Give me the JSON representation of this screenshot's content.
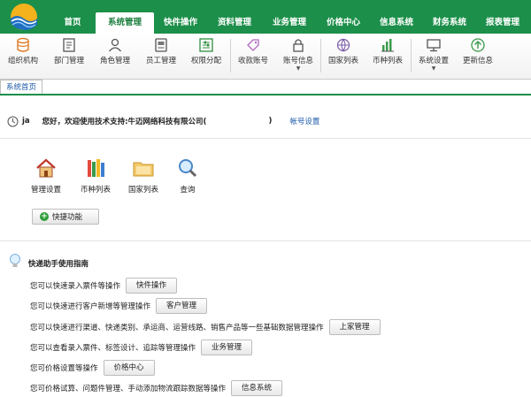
{
  "nav": {
    "items": [
      "首页",
      "系统管理",
      "快件操作",
      "资料管理",
      "业务管理",
      "价格中心",
      "信息系统",
      "财务系统",
      "报表管理"
    ],
    "active": "系统管理"
  },
  "toolbar": {
    "items": [
      {
        "label": "组织机构",
        "icon": "database-icon"
      },
      {
        "label": "部门管理",
        "icon": "document-icon"
      },
      {
        "label": "角色管理",
        "icon": "user-icon"
      },
      {
        "label": "员工管理",
        "icon": "id-card-icon"
      },
      {
        "label": "权限分配",
        "icon": "sliders-icon"
      },
      {
        "label": "收款账号",
        "icon": "tag-icon"
      },
      {
        "label": "账号信息",
        "icon": "lock-icon"
      },
      {
        "label": "国家列表",
        "icon": "globe-icon"
      },
      {
        "label": "币种列表",
        "icon": "bar-chart-icon"
      },
      {
        "label": "系统设置",
        "icon": "monitor-icon"
      },
      {
        "label": "更新信息",
        "icon": "up-arrow-icon"
      }
    ]
  },
  "tabs": {
    "home": "系统首页"
  },
  "welcome": {
    "user": "ja",
    "text": "您好，欢迎使用技术支持:牛迈网络科技有限公司(",
    "close": ")",
    "account_link": "帐号设置"
  },
  "shortcuts": {
    "items": [
      {
        "label": "管理设置",
        "icon": "house-icon"
      },
      {
        "label": "币种列表",
        "icon": "books-icon"
      },
      {
        "label": "国家列表",
        "icon": "folder-icon"
      },
      {
        "label": "查询",
        "icon": "magnifier-icon"
      }
    ],
    "quick_button": "快捷功能"
  },
  "guide": {
    "title": "快递助手使用指南",
    "rows": [
      {
        "desc": "您可以快速录入票件等操作",
        "button": "快件操作"
      },
      {
        "desc": "您可以快速进行客户新增等管理操作",
        "button": "客户管理"
      },
      {
        "desc": "您可以快速进行渠道、快递类别、承运商、运营线路、销售产品等一些基础数据管理操作",
        "button": "上家管理"
      },
      {
        "desc": "您可以查看录入票件、标签设计、追踪等管理操作",
        "button": "业务管理"
      },
      {
        "desc": "您可价格设置等操作",
        "button": "价格中心"
      },
      {
        "desc": "您可价格试算、问题件管理、手动添加物流跟踪数据等操作",
        "button": "信息系统"
      }
    ]
  },
  "colors": {
    "brand_green": "#1c8f4a",
    "link_blue": "#1a5aa8"
  }
}
